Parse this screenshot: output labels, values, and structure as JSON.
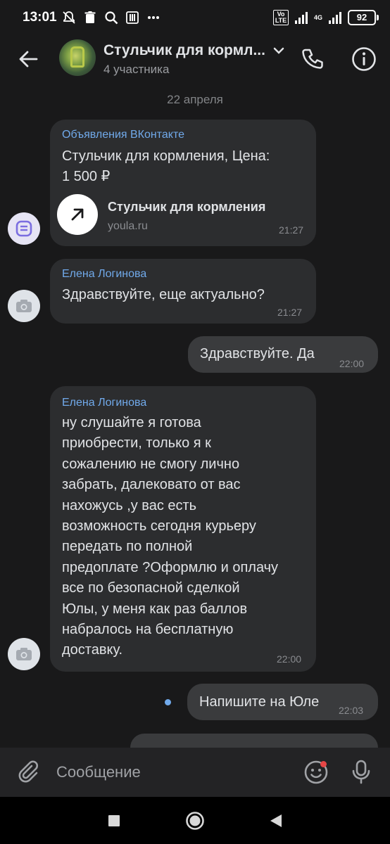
{
  "status": {
    "time": "13:01",
    "lte_tag": "Vo LTE",
    "net_tag": "4G",
    "battery": "92",
    "icons": [
      "notifications-off-icon",
      "trash-icon",
      "search-icon",
      "sim-icon",
      "more-dots-icon",
      "signal-icon",
      "wifi-signal-icon",
      "battery-icon"
    ]
  },
  "header": {
    "title": "Стульчик для кормл...",
    "subtitle": "4 участника",
    "icons": [
      "back-arrow-icon",
      "chevron-down-icon",
      "phone-icon",
      "info-icon"
    ]
  },
  "date_separator": "22 апреля",
  "messages": [
    {
      "sender": "Объявления ВКонтакте",
      "text_lines": [
        "Стульчик для кормления, Цена:",
        "1 500 ₽"
      ],
      "link_title": "Стульчик для кормления",
      "link_domain": "youla.ru",
      "time": "21:27",
      "direction": "in"
    },
    {
      "sender": "Елена Логинова",
      "text_lines": [
        "Здравствуйте, еще актуально?"
      ],
      "time": "21:27",
      "direction": "in"
    },
    {
      "text_lines": [
        "Здравствуйте. Да"
      ],
      "time": "22:00",
      "direction": "out"
    },
    {
      "sender": "Елена Логинова",
      "text_lines": [
        "ну слушайте я готова",
        "приобрести, только я к",
        "сожалению не смогу лично",
        "забрать, далековато от вас",
        "нахожусь ,у вас есть",
        "возможность сегодня курьеру",
        "передать по полной",
        "предоплате ?Оформлю и оплачу",
        "все по безопасной сделкой",
        "Юлы, у меня как раз баллов",
        "набралось на бесплатную",
        "доставку."
      ],
      "time": "22:00",
      "direction": "in"
    },
    {
      "text_lines": [
        "Напишите на Юле"
      ],
      "time": "22:03",
      "direction": "out",
      "unread": true
    }
  ],
  "composer": {
    "placeholder": "Сообщение",
    "icons": [
      "paperclip-icon",
      "sticker-smile-icon",
      "microphone-icon"
    ]
  },
  "navbar": {
    "icons": [
      "recents-square-icon",
      "home-circle-icon",
      "back-triangle-icon"
    ]
  },
  "colors": {
    "background": "#19191a",
    "bubble_in": "#2c2d2f",
    "bubble_out": "#3a3b3d",
    "accent": "#71aaeb",
    "text": "#e1e3e6",
    "muted": "#8a8c90"
  }
}
